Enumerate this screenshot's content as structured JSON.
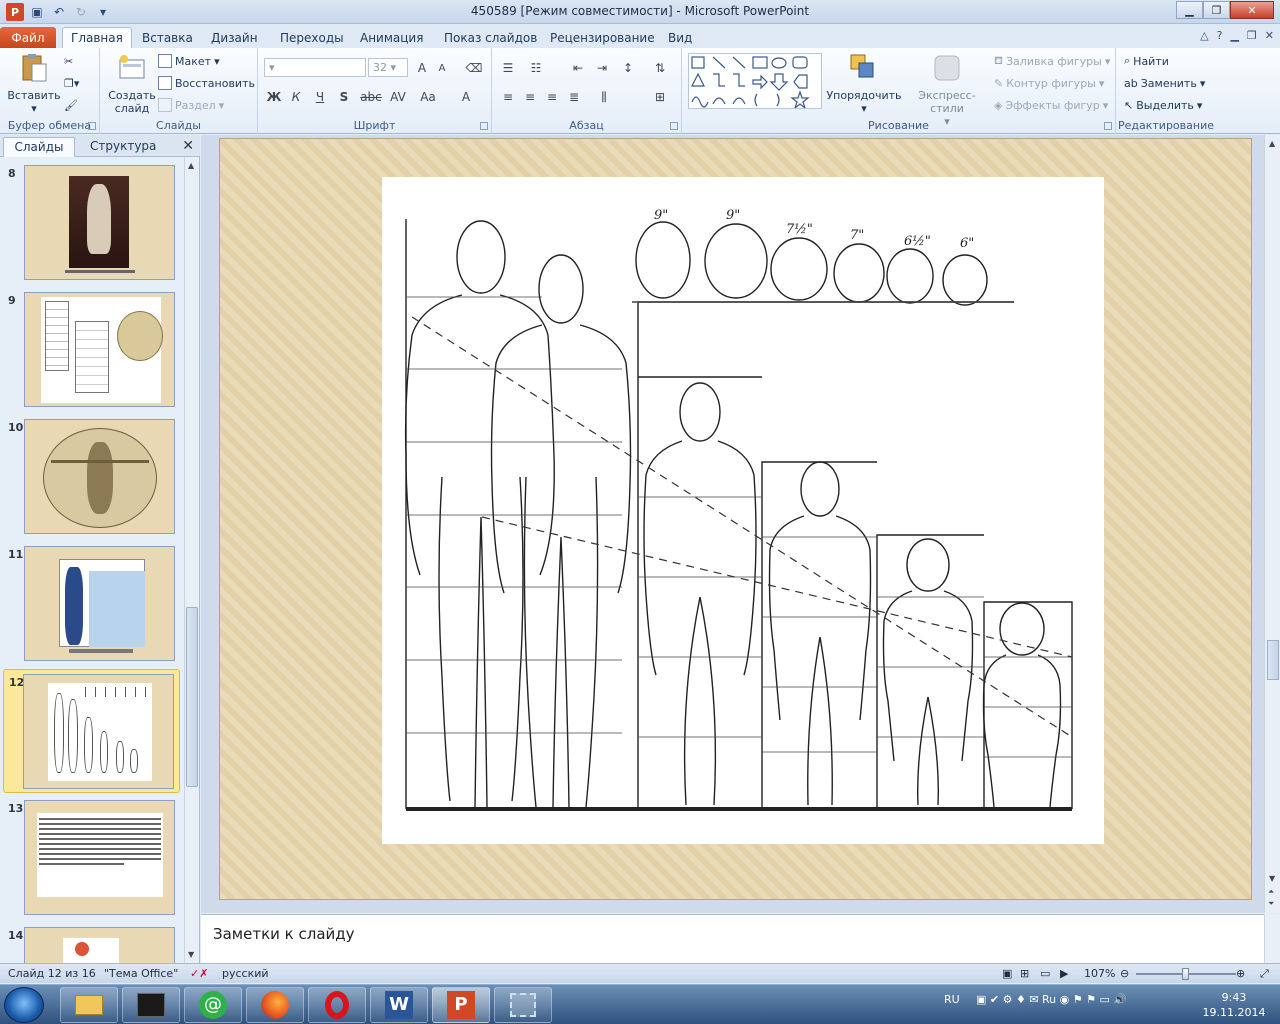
{
  "window": {
    "title": "450589 [Режим совместимости] - Microsoft PowerPoint"
  },
  "tabs": {
    "file": "Файл",
    "home": "Главная",
    "insert": "Вставка",
    "design": "Дизайн",
    "transitions": "Переходы",
    "animation": "Анимация",
    "slideshow": "Показ слайдов",
    "review": "Рецензирование",
    "view": "Вид"
  },
  "ribbon": {
    "clipboard": {
      "label": "Буфер обмена",
      "paste": "Вставить"
    },
    "slides": {
      "label": "Слайды",
      "new_line1": "Создать",
      "new_line2": "слайд",
      "layout": "Макет",
      "reset": "Восстановить",
      "section": "Раздел"
    },
    "font": {
      "label": "Шрифт",
      "size": "32",
      "bold": "Ж",
      "italic": "К",
      "underline": "Ч",
      "shadow": "S",
      "strike": "abc",
      "spacing": "AV",
      "case": "Aa",
      "grow": "A",
      "shrink": "A",
      "color": "A"
    },
    "paragraph": {
      "label": "Абзац"
    },
    "drawing": {
      "label": "Рисование",
      "arrange": "Упорядочить",
      "quick_styles": "Экспресс-стили",
      "fill": "Заливка фигуры",
      "outline": "Контур фигуры",
      "effects": "Эффекты фигур"
    },
    "editing": {
      "label": "Редактирование",
      "find": "Найти",
      "replace": "Заменить",
      "select": "Выделить"
    }
  },
  "pane": {
    "tab_slides": "Слайды",
    "tab_outline": "Структура",
    "thumbs": [
      {
        "num": "8"
      },
      {
        "num": "9"
      },
      {
        "num": "10"
      },
      {
        "num": "11"
      },
      {
        "num": "12"
      },
      {
        "num": "13"
      },
      {
        "num": "14"
      }
    ]
  },
  "slide": {
    "head_labels": [
      "9\"",
      "9\"",
      "7½\"",
      "7\"",
      "6½\"",
      "6\""
    ]
  },
  "notes": {
    "placeholder": "Заметки к слайду"
  },
  "status": {
    "slide_info": "Слайд 12 из 16",
    "theme": "\"Тема Office\"",
    "language": "русский",
    "zoom": "107%"
  },
  "taskbar": {
    "lang": "RU",
    "time": "9:43",
    "date": "19.11.2014"
  },
  "colors": {
    "file_tab": "#c8461c",
    "slide_bg": "#e4d0a7",
    "selection": "#fde89a"
  }
}
